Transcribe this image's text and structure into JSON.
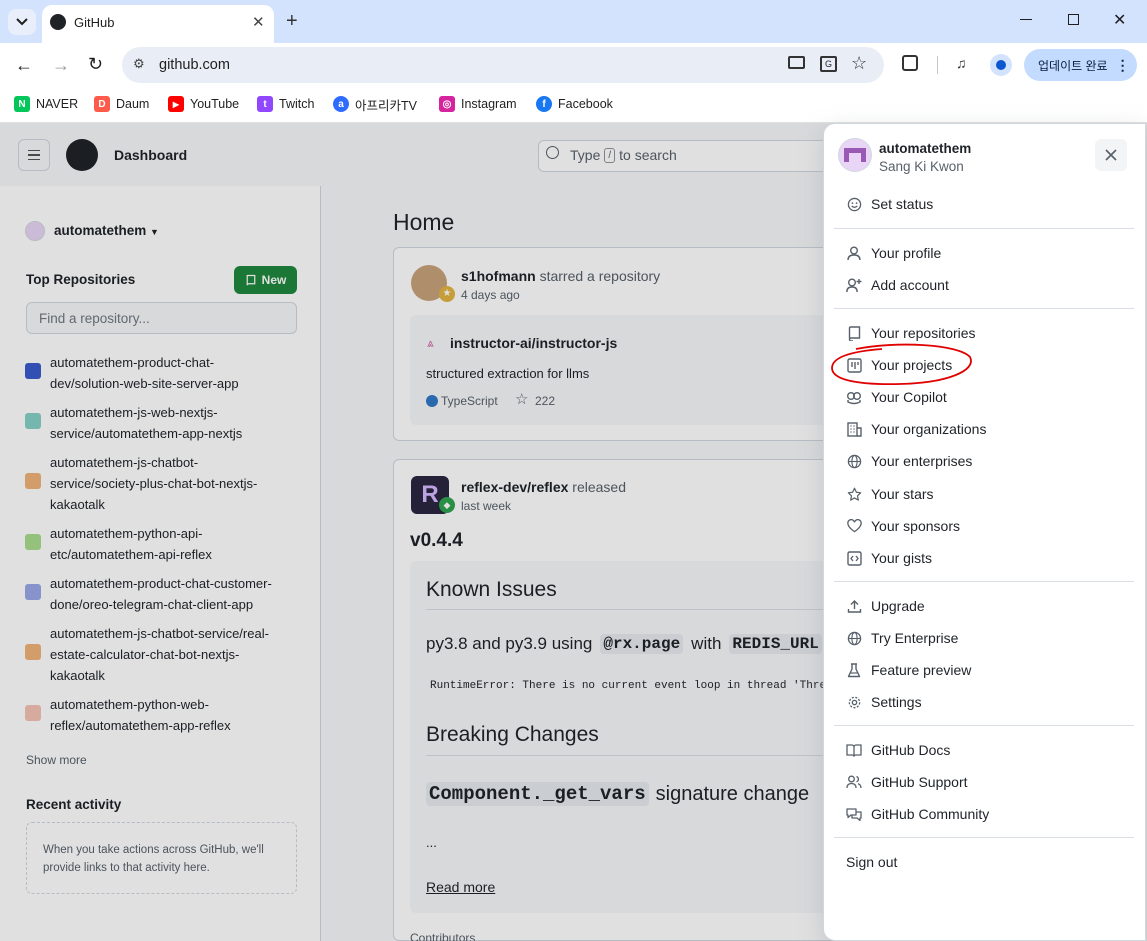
{
  "browser": {
    "tab_title": "GitHub",
    "url": "github.com",
    "update_label": "업데이트 완료",
    "bookmarks": [
      "NAVER",
      "Daum",
      "YouTube",
      "Twitch",
      "아프리카TV",
      "Instagram",
      "Facebook"
    ]
  },
  "header": {
    "title": "Dashboard",
    "search_prefix": "Type",
    "search_key": "/",
    "search_suffix": "to search"
  },
  "sidebar": {
    "account": "automatethem",
    "top_repos_title": "Top Repositories",
    "new_label": "New",
    "find_placeholder": "Find a repository...",
    "repos": [
      {
        "line1": "automatethem-product-chat-",
        "line2": "dev/solution-web-site-server-app",
        "line3": ""
      },
      {
        "line1": "automatethem-js-web-nextjs-",
        "line2": "service/automatethem-app-nextjs",
        "line3": ""
      },
      {
        "line1": "automatethem-js-chatbot-",
        "line2": "service/society-plus-chat-bot-nextjs-",
        "line3": "kakaotalk"
      },
      {
        "line1": "automatethem-python-api-",
        "line2": "etc/automatethem-api-reflex",
        "line3": ""
      },
      {
        "line1": "automatethem-product-chat-customer-",
        "line2": "done/oreo-telegram-chat-client-app",
        "line3": ""
      },
      {
        "line1": "automatethem-js-chatbot-service/real-",
        "line2": "estate-calculator-chat-bot-nextjs-",
        "line3": "kakaotalk"
      },
      {
        "line1": "automatethem-python-web-",
        "line2": "reflex/automatethem-app-reflex",
        "line3": ""
      }
    ],
    "show_more": "Show more",
    "recent_title": "Recent activity",
    "recent_line1": "When you take actions across GitHub, we'll",
    "recent_line2": "provide links to that activity here."
  },
  "feed": {
    "home_title": "Home",
    "star_event": {
      "user": "s1hofmann",
      "action": "starred a repository",
      "time": "4 days ago",
      "repo": "instructor-ai/instructor-js",
      "desc": "structured extraction for llms",
      "lang": "TypeScript",
      "stars": "222"
    },
    "release_event": {
      "repo": "reflex-dev/reflex",
      "action": "released",
      "time": "last week",
      "version": "v0.4.4",
      "known_issues": "Known Issues",
      "py_text1": "py3.8 and py3.9 using",
      "code1": "@rx.page",
      "py_text2": "with",
      "code2": "REDIS_URL",
      "runtime_error": "RuntimeError: There is no current event loop in thread 'Thre",
      "breaking": "Breaking Changes",
      "code3": "Component._get_vars",
      "sig_text": "signature change",
      "ellipsis": "...",
      "read_more": "Read more",
      "contributors": "Contributors"
    }
  },
  "menu": {
    "username": "automatethem",
    "fullname": "Sang Ki Kwon",
    "set_status": "Set status",
    "group1": [
      "Your profile",
      "Add account"
    ],
    "group2": [
      "Your repositories",
      "Your projects",
      "Your Copilot",
      "Your organizations",
      "Your enterprises",
      "Your stars",
      "Your sponsors",
      "Your gists"
    ],
    "group3": [
      "Upgrade",
      "Try Enterprise",
      "Feature preview",
      "Settings"
    ],
    "group4": [
      "GitHub Docs",
      "GitHub Support",
      "GitHub Community"
    ],
    "sign_out": "Sign out"
  },
  "colors": {
    "accent": "#0969da",
    "new_button": "#1f883d",
    "annotation": "#e00000",
    "tab_bar": "#d3e3fd"
  }
}
